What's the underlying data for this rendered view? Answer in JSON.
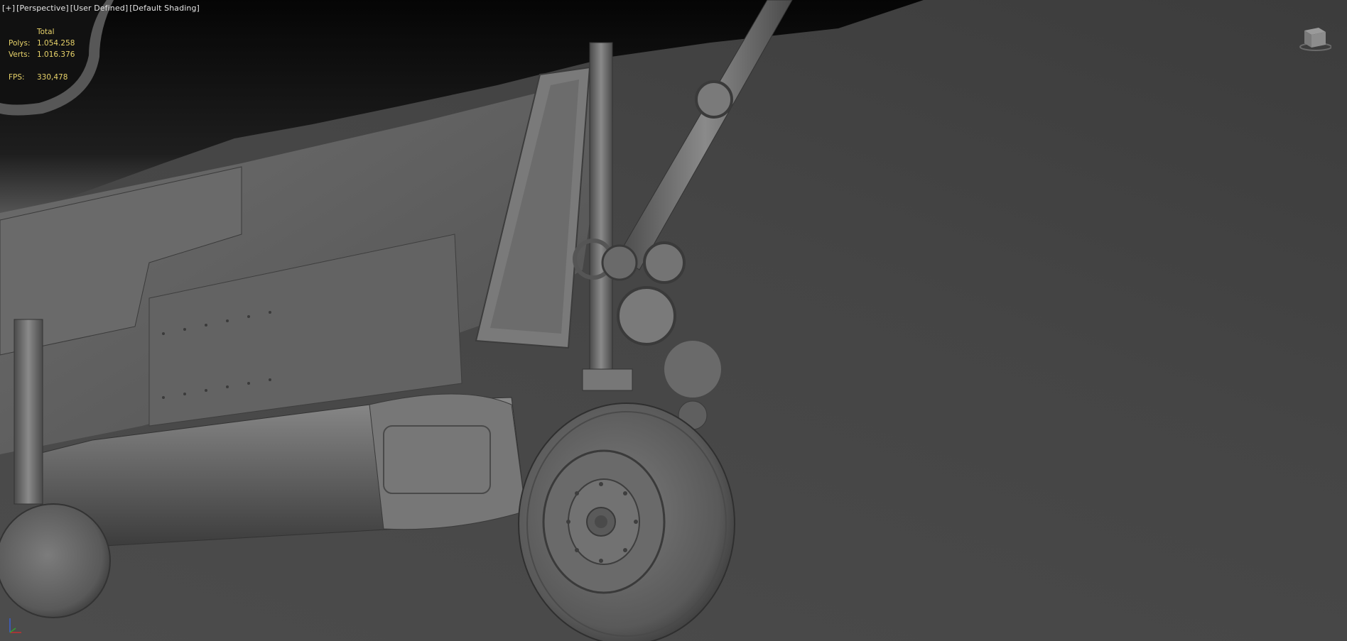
{
  "viewport": {
    "labels": [
      "+",
      "Perspective",
      "User Defined",
      "Default Shading"
    ]
  },
  "stats": {
    "header": "Total",
    "polys_label": "Polys:",
    "polys_value": "1.054.258",
    "verts_label": "Verts:",
    "verts_value": "1.016.376",
    "fps_label": "FPS:",
    "fps_value": "330,478"
  },
  "icons": {
    "viewcube": "viewcube-icon",
    "axis": "axis-tripod-icon"
  },
  "colors": {
    "stats_text": "#e8d36a",
    "label_text": "#e6e6e6",
    "background": "#444444",
    "model": "#6f6f6f"
  }
}
